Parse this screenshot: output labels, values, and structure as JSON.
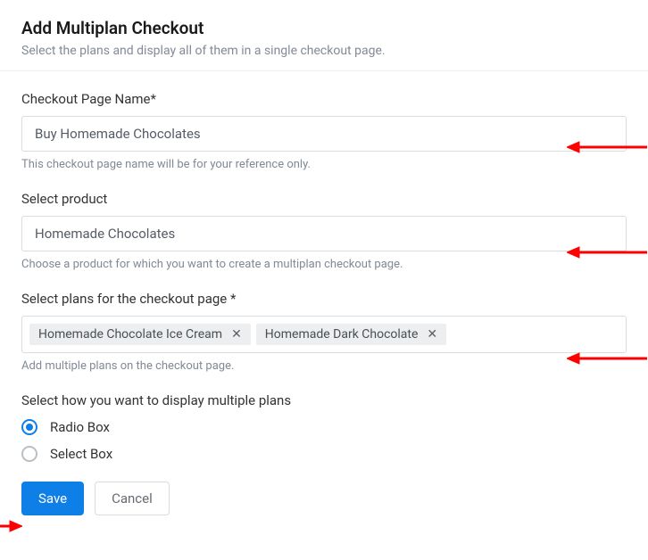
{
  "header": {
    "title": "Add Multiplan Checkout",
    "subtitle": "Select the plans and display all of them in a single checkout page."
  },
  "fields": {
    "page_name": {
      "label": "Checkout Page Name*",
      "value": "Buy Homemade Chocolates",
      "help": "This checkout page name will be for your reference only."
    },
    "product": {
      "label": "Select product",
      "value": "Homemade Chocolates",
      "help": "Choose a product for which you want to create a multiplan checkout page."
    },
    "plans": {
      "label": "Select plans for the checkout page *",
      "chips": [
        "Homemade Chocolate Ice Cream",
        "Homemade Dark Chocolate"
      ],
      "help": "Add multiple plans on the checkout page."
    },
    "display": {
      "label": "Select how you want to display multiple plans",
      "options": [
        {
          "label": "Radio Box",
          "checked": true
        },
        {
          "label": "Select Box",
          "checked": false
        }
      ]
    }
  },
  "buttons": {
    "save": "Save",
    "cancel": "Cancel"
  }
}
